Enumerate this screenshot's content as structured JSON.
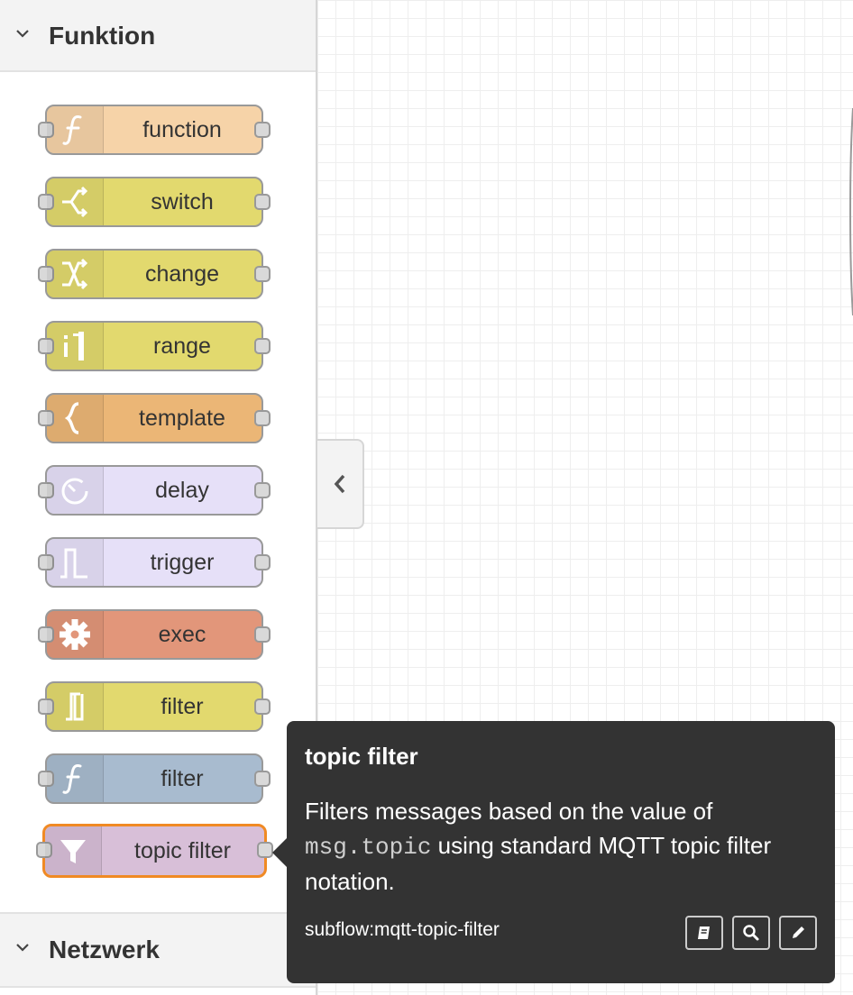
{
  "palette": {
    "categories": [
      {
        "label": "Funktion"
      },
      {
        "label": "Netzwerk"
      }
    ],
    "nodes": [
      {
        "label": "function",
        "icon": "function-icon",
        "color": "#f6d3a8"
      },
      {
        "label": "switch",
        "icon": "switch-icon",
        "color": "#e2d96e"
      },
      {
        "label": "change",
        "icon": "shuffle-icon",
        "color": "#e2d96e"
      },
      {
        "label": "range",
        "icon": "range-icon",
        "color": "#e2d96e"
      },
      {
        "label": "template",
        "icon": "template-icon",
        "color": "#ebb676"
      },
      {
        "label": "delay",
        "icon": "timer-icon",
        "color": "#e6e0f8"
      },
      {
        "label": "trigger",
        "icon": "trigger-icon",
        "color": "#e6e0f8"
      },
      {
        "label": "exec",
        "icon": "gear-icon",
        "color": "#e2967a"
      },
      {
        "label": "filter",
        "icon": "rbe-icon",
        "color": "#e2d96e"
      },
      {
        "label": "filter",
        "icon": "function-icon",
        "color": "#a8bbcf"
      },
      {
        "label": "topic filter",
        "icon": "funnel-icon",
        "color": "#d8bfd8",
        "selected": true
      }
    ]
  },
  "tooltip": {
    "title": "topic filter",
    "desc_before": "Filters messages based on the value of",
    "desc_code": "msg.topic",
    "desc_after": "using standard MQTT topic filter notation.",
    "type": "subflow:mqtt-topic-filter",
    "buttons": [
      "book-icon",
      "search-icon",
      "pencil-icon"
    ]
  }
}
